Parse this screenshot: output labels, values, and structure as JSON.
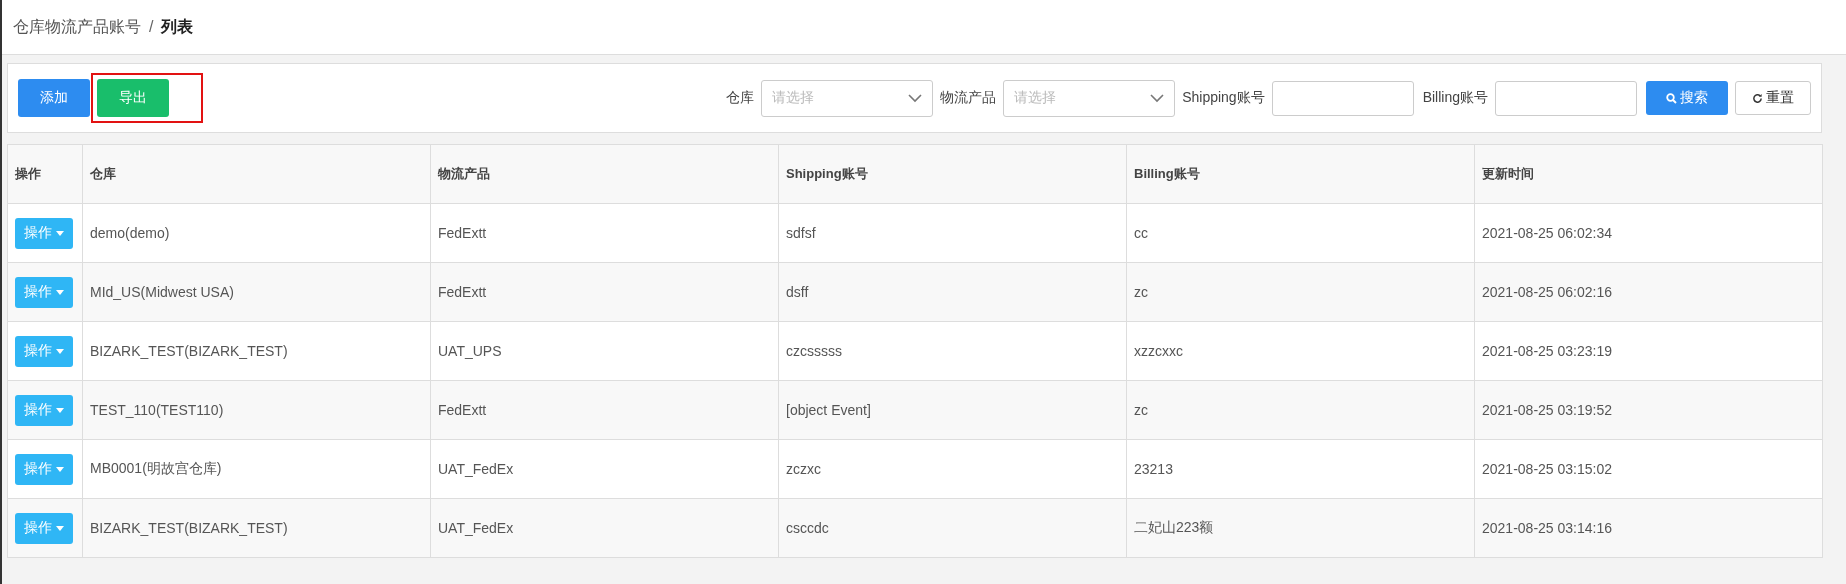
{
  "breadcrumb": [
    {
      "label": "仓库物流产品账号",
      "current": false
    },
    {
      "label": "列表",
      "current": true
    }
  ],
  "breadcrumb_separator": "/",
  "actions": [
    {
      "label": "添加",
      "kind": "primary",
      "highlighted": false
    },
    {
      "label": "导出",
      "kind": "success",
      "highlighted": true
    }
  ],
  "filters": [
    {
      "label": "仓库",
      "kind": "select",
      "placeholder": "请选择"
    },
    {
      "label": "物流产品",
      "kind": "select",
      "placeholder": "请选择"
    },
    {
      "label": "Shipping账号",
      "kind": "input"
    },
    {
      "label": "Billing账号",
      "kind": "input"
    }
  ],
  "search_button": "搜索",
  "reset_button": "重置",
  "table": {
    "columns": [
      "操作",
      "仓库",
      "物流产品",
      "Shipping账号",
      "Billing账号",
      "更新时间"
    ],
    "rows": [
      {
        "cells": [
          "操作",
          "demo(demo)",
          "FedExtt",
          "sdfsf",
          "cc",
          "2021-08-25 06:02:34"
        ]
      },
      {
        "cells": [
          "操作",
          "MId_US(Midwest USA)",
          "FedExtt",
          "dsff",
          "zc",
          "2021-08-25 06:02:16"
        ]
      },
      {
        "cells": [
          "操作",
          "BIZARK_TEST(BIZARK_TEST)",
          "UAT_UPS",
          "czcsssss",
          "xzzcxxc",
          "2021-08-25 03:23:19"
        ]
      },
      {
        "cells": [
          "操作",
          "TEST_110(TEST110)",
          "FedExtt",
          "[object Event]",
          "zc",
          "2021-08-25 03:19:52"
        ]
      },
      {
        "cells": [
          "操作",
          "MB0001(明故宫仓库)",
          "UAT_FedEx",
          "zczxc",
          "23213",
          "2021-08-25 03:15:02"
        ]
      },
      {
        "cells": [
          "操作",
          "BIZARK_TEST(BIZARK_TEST)",
          "UAT_FedEx",
          "csccdc",
          "二妃山223额",
          "2021-08-25 03:14:16"
        ]
      }
    ]
  }
}
